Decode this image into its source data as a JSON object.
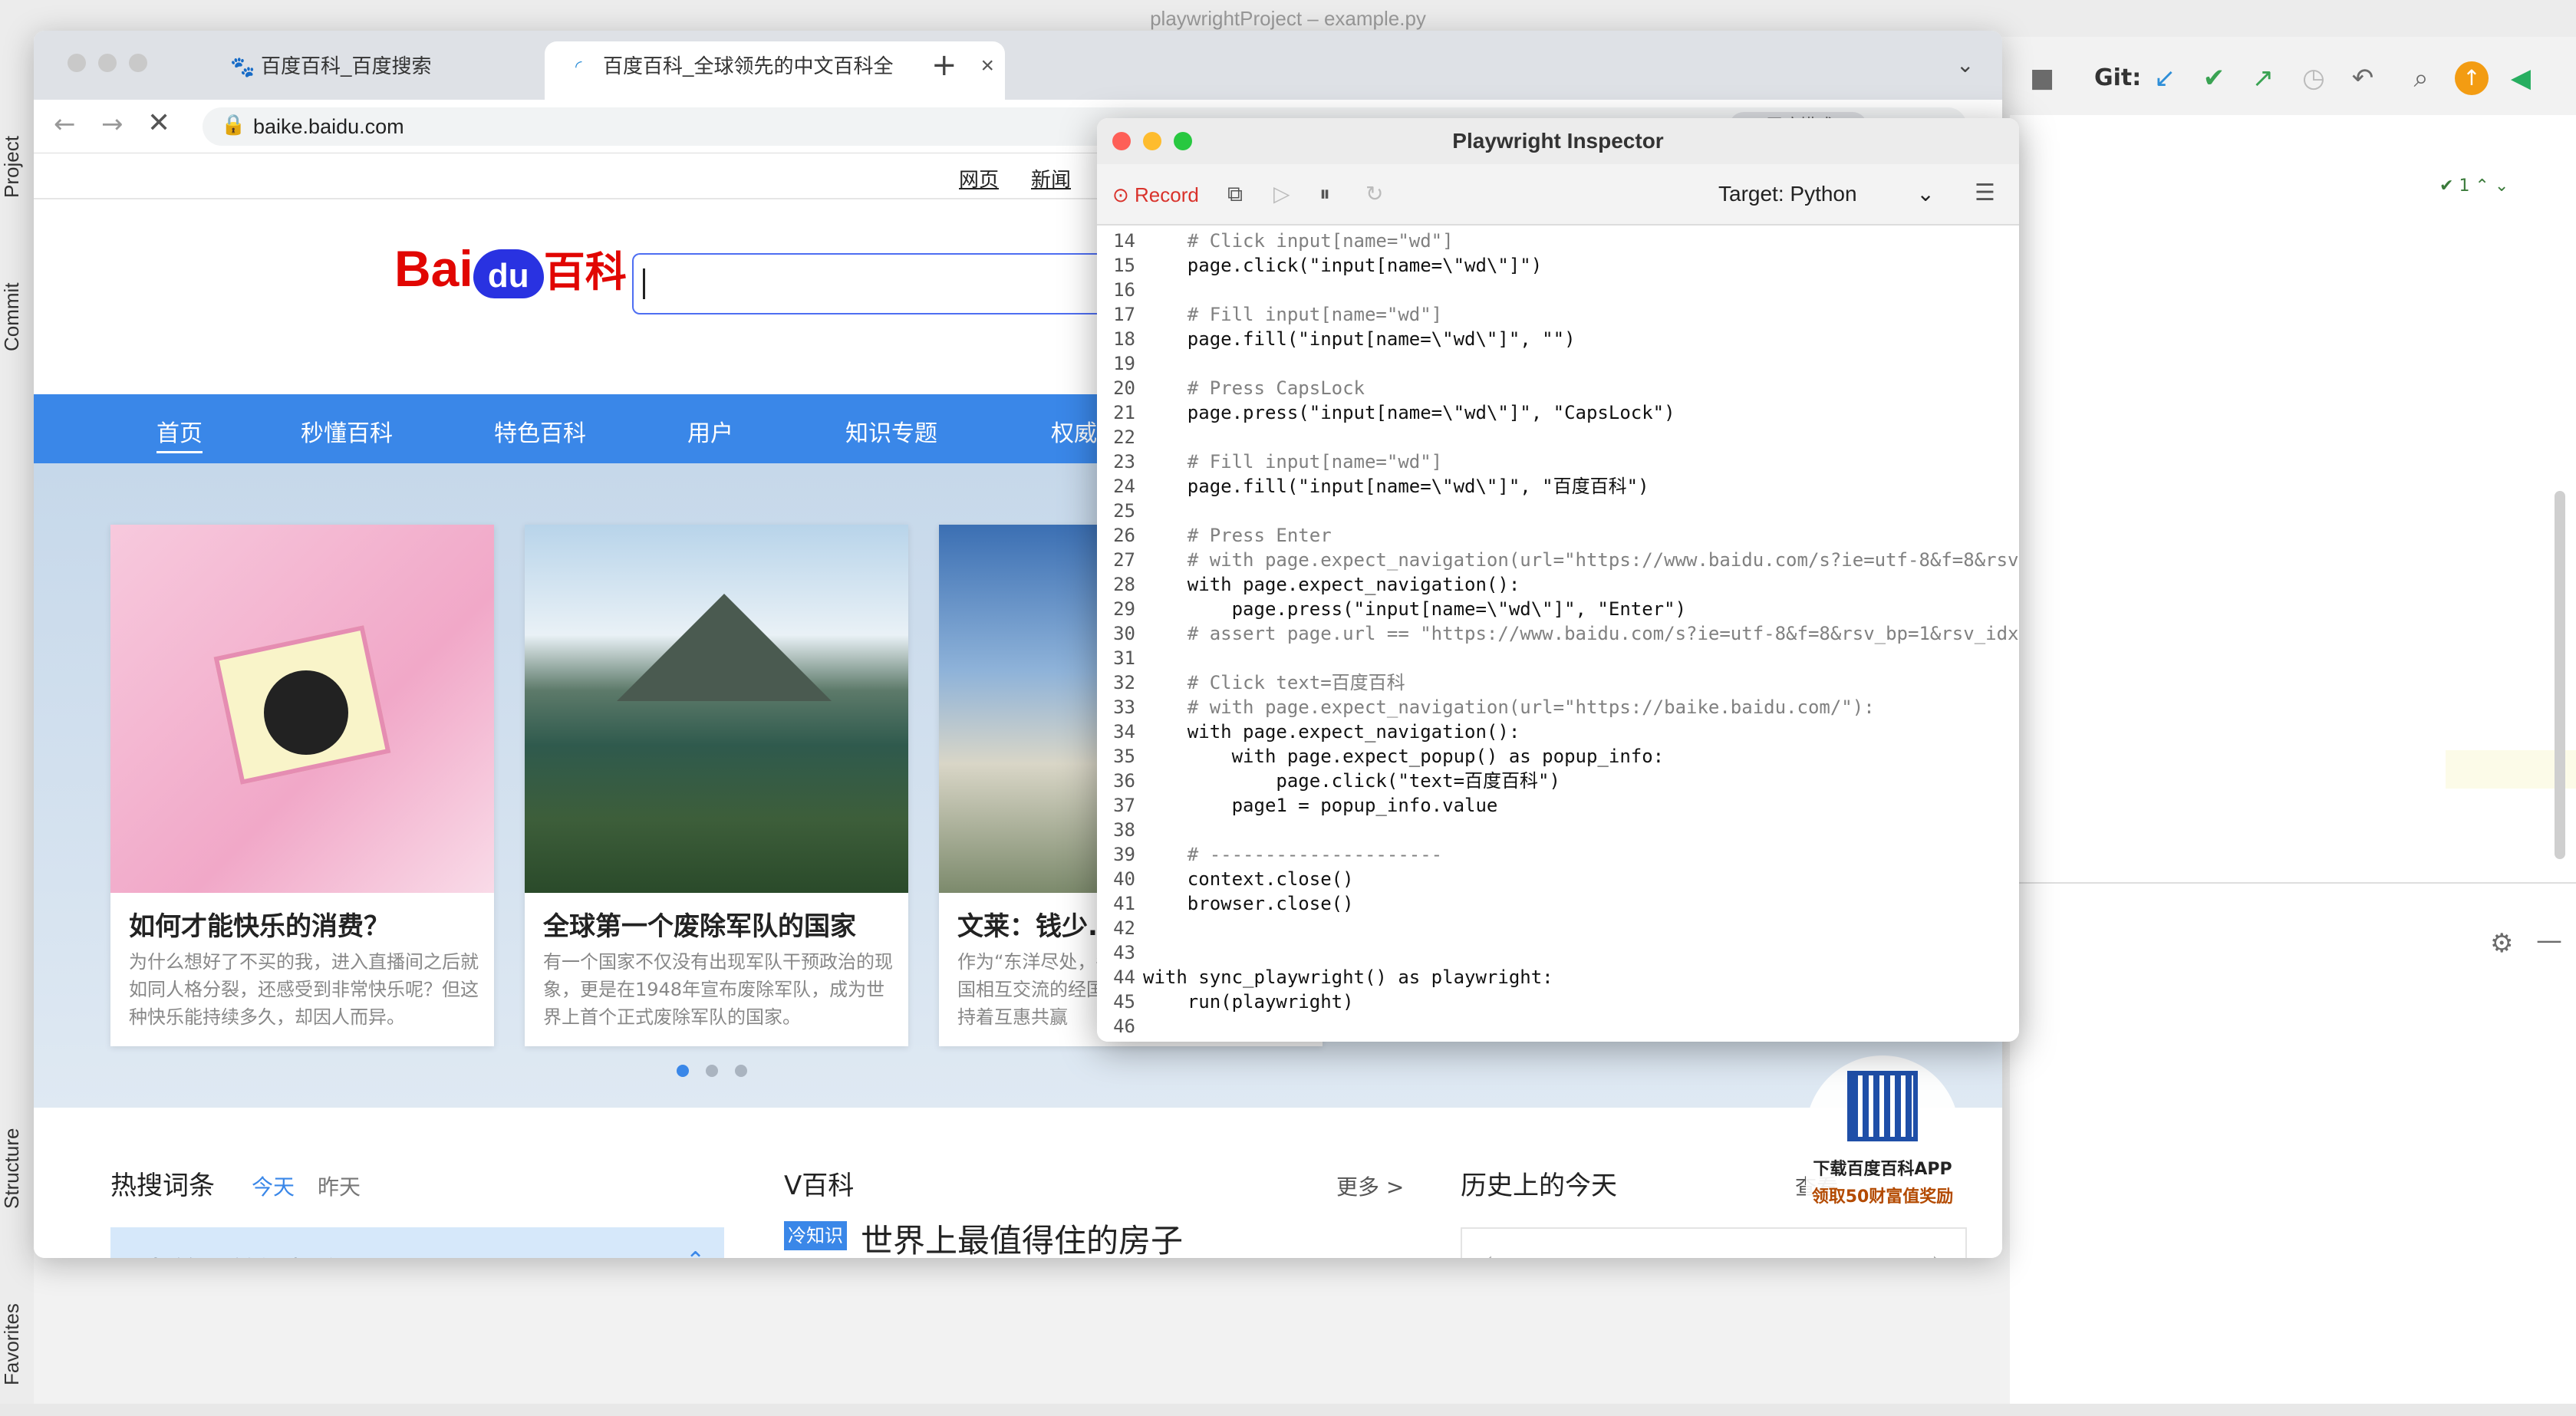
{
  "ide": {
    "title": "playwrightProject – example.py",
    "git_label": "Git:",
    "left_tabs": [
      "Project",
      "Commit",
      "Structure",
      "Favorites"
    ],
    "match_count": "1"
  },
  "browser": {
    "tabs": [
      {
        "label": "百度百科_百度搜索",
        "close": "×"
      },
      {
        "label": "百度百科_全球领先的中文百科全",
        "close": "×"
      }
    ],
    "new_tab": "+",
    "url": "baike.baidu.com",
    "ext_label": "无痕模式"
  },
  "baike": {
    "top_links": [
      "网页",
      "新闻"
    ],
    "logo_text": "Bai",
    "logo_du": "du",
    "logo_suffix": "百科",
    "nav": [
      "首页",
      "秒懂百科",
      "特色百科",
      "用户",
      "知识专题",
      "权威"
    ],
    "cards": [
      {
        "title": "如何才能快乐的消费？",
        "desc": "为什么想好了不买的我，进入直播间之后就如同人格分裂，还感受到非常快乐呢？但这种快乐能持续多久，却因人而异。"
      },
      {
        "title": "全球第一个废除军队的国家",
        "desc": "有一个国家不仅没有出现军队干预政治的现象，更是在1948年宣布废除军队，成为世界上首个正式废除军队的国家。"
      },
      {
        "title": "文莱：钱少...",
        "desc": "作为“东洋尽处，各国相互交流的经国保持着互惠共赢"
      }
    ],
    "hot_title": "热搜词条",
    "hot_today": "今天",
    "hot_yesterday": "昨天",
    "hot_item": "中美三首视频会晤",
    "v_title": "V百科",
    "v_more": "更多 >",
    "v_badge": "冷知识",
    "v_headline": "世界上最值得住的房子",
    "history_title": "历史上的今天",
    "history_more": "查看",
    "app_line1": "下载百度百科APP",
    "app_line2": "领取50财富值奖励"
  },
  "inspector": {
    "title": "Playwright Inspector",
    "record_label": "Record",
    "target_label": "Target:",
    "target_value": "Python",
    "lines": [
      {
        "n": "14",
        "t": "    # Click input[name=\"wd\"]",
        "c": "cm"
      },
      {
        "n": "15",
        "t": "    page.click(\"input[name=\\\"wd\\\"]\")",
        "c": "pl"
      },
      {
        "n": "16",
        "t": "",
        "c": "pl"
      },
      {
        "n": "17",
        "t": "    # Fill input[name=\"wd\"]",
        "c": "cm"
      },
      {
        "n": "18",
        "t": "    page.fill(\"input[name=\\\"wd\\\"]\", \"\")",
        "c": "pl"
      },
      {
        "n": "19",
        "t": "",
        "c": "pl"
      },
      {
        "n": "20",
        "t": "    # Press CapsLock",
        "c": "cm"
      },
      {
        "n": "21",
        "t": "    page.press(\"input[name=\\\"wd\\\"]\", \"CapsLock\")",
        "c": "pl"
      },
      {
        "n": "22",
        "t": "",
        "c": "pl"
      },
      {
        "n": "23",
        "t": "    # Fill input[name=\"wd\"]",
        "c": "cm"
      },
      {
        "n": "24",
        "t": "    page.fill(\"input[name=\\\"wd\\\"]\", \"百度百科\")",
        "c": "pl"
      },
      {
        "n": "25",
        "t": "",
        "c": "pl"
      },
      {
        "n": "26",
        "t": "    # Press Enter",
        "c": "cm"
      },
      {
        "n": "27",
        "t": "    # with page.expect_navigation(url=\"https://www.baidu.com/s?ie=utf-8&f=8&rsv",
        "c": "cm"
      },
      {
        "n": "28",
        "t": "    with page.expect_navigation():",
        "c": "pl"
      },
      {
        "n": "29",
        "t": "        page.press(\"input[name=\\\"wd\\\"]\", \"Enter\")",
        "c": "pl"
      },
      {
        "n": "30",
        "t": "    # assert page.url == \"https://www.baidu.com/s?ie=utf-8&f=8&rsv_bp=1&rsv_idx",
        "c": "cm"
      },
      {
        "n": "31",
        "t": "",
        "c": "pl"
      },
      {
        "n": "32",
        "t": "    # Click text=百度百科",
        "c": "cm"
      },
      {
        "n": "33",
        "t": "    # with page.expect_navigation(url=\"https://baike.baidu.com/\"):",
        "c": "cm"
      },
      {
        "n": "34",
        "t": "    with page.expect_navigation():",
        "c": "pl"
      },
      {
        "n": "35",
        "t": "        with page.expect_popup() as popup_info:",
        "c": "pl"
      },
      {
        "n": "36",
        "t": "            page.click(\"text=百度百科\")",
        "c": "pl"
      },
      {
        "n": "37",
        "t": "        page1 = popup_info.value",
        "c": "pl"
      },
      {
        "n": "38",
        "t": "",
        "c": "pl"
      },
      {
        "n": "39",
        "t": "    # ---------------------",
        "c": "cm"
      },
      {
        "n": "40",
        "t": "    context.close()",
        "c": "pl"
      },
      {
        "n": "41",
        "t": "    browser.close()",
        "c": "pl"
      },
      {
        "n": "42",
        "t": "",
        "c": "pl"
      },
      {
        "n": "43",
        "t": "",
        "c": "pl"
      },
      {
        "n": "44",
        "t": "with sync_playwright() as playwright:",
        "c": "pl"
      },
      {
        "n": "45",
        "t": "    run(playwright)",
        "c": "pl"
      },
      {
        "n": "46",
        "t": "",
        "c": "pl"
      }
    ]
  },
  "colors": {
    "baidu_blue": "#2932e1",
    "baidu_red": "#e10602",
    "nav_blue": "#3a87e8",
    "record_red": "#d9322b"
  }
}
